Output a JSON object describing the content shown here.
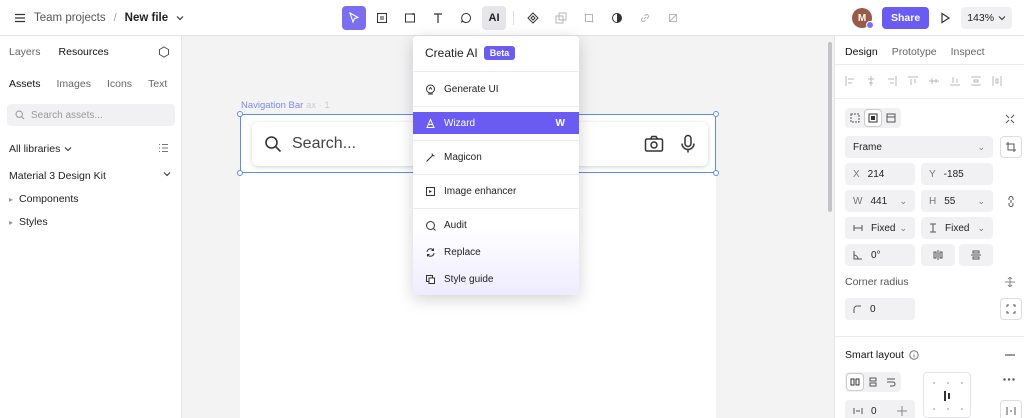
{
  "topbar": {
    "menu_icon": "hamburger-icon",
    "project": "Team projects",
    "separator": "/",
    "file": "New file",
    "tools": [
      "pointer-icon",
      "frame-icon",
      "rectangle-icon",
      "text-icon",
      "comment-icon",
      "AI"
    ],
    "tools_secondary": [
      "component-icon",
      "duplicate-icon",
      "crop-icon",
      "contrast-icon",
      "link-icon",
      "transform-icon"
    ],
    "avatar_initial": "M",
    "share_label": "Share",
    "zoom": "143%"
  },
  "left_panel": {
    "tabs": [
      "Layers",
      "Resources"
    ],
    "active_tab": "Resources",
    "sub_tabs": [
      "Assets",
      "Images",
      "Icons",
      "Text"
    ],
    "active_sub_tab": "Assets",
    "search_placeholder": "Search assets...",
    "library_label": "All libraries",
    "kit_name": "Material 3 Design Kit",
    "items": [
      "Components",
      "Styles"
    ]
  },
  "canvas": {
    "frame_label": "Navigation Bar",
    "frame_label_ghost": "ax · 1",
    "search_placeholder": "Search..."
  },
  "ai_menu": {
    "title": "Creatie AI",
    "badge": "Beta",
    "items": [
      {
        "label": "Generate UI",
        "icon": "generate-icon",
        "shortcut": ""
      },
      {
        "label": "Wizard",
        "icon": "wizard-icon",
        "shortcut": "W"
      },
      {
        "label": "Magicon",
        "icon": "magic-wand-icon",
        "shortcut": ""
      },
      {
        "label": "Image enhancer",
        "icon": "image-icon",
        "shortcut": ""
      },
      {
        "label": "Audit",
        "icon": "audit-icon",
        "shortcut": ""
      },
      {
        "label": "Replace",
        "icon": "replace-icon",
        "shortcut": ""
      },
      {
        "label": "Style guide",
        "icon": "style-guide-icon",
        "shortcut": ""
      }
    ],
    "highlighted": "Wizard"
  },
  "right_panel": {
    "tabs": [
      "Design",
      "Prototype",
      "Inspect"
    ],
    "active_tab": "Design",
    "frame_type": "Frame",
    "x_label": "X",
    "x_value": "214",
    "y_label": "Y",
    "y_value": "-185",
    "w_label": "W",
    "w_value": "441",
    "h_label": "H",
    "h_value": "55",
    "width_mode": "Fixed",
    "height_mode": "Fixed",
    "rotation": "0°",
    "corner_radius_label": "Corner radius",
    "corner_radius_value": "0",
    "smart_layout_label": "Smart layout",
    "gap_value": "0"
  },
  "colors": {
    "accent": "#6a5bf2",
    "selection": "#5b8bf5"
  }
}
